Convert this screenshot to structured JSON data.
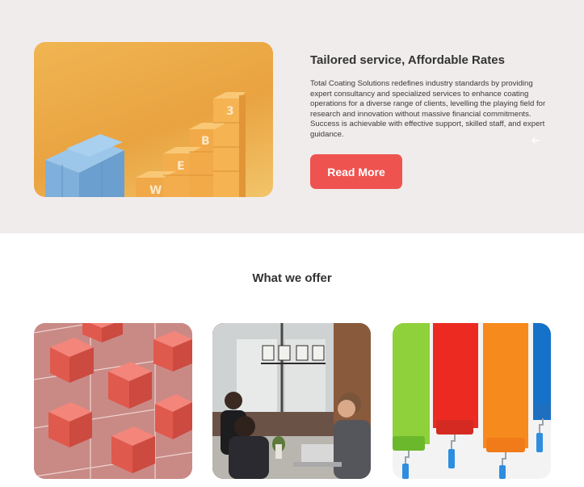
{
  "hero": {
    "title": "Tailored service, Affordable Rates",
    "description": "Total Coating Solutions redefines industry standards by providing expert consultancy and specialized services to enhance coating operations for a diverse range of clients, levelling the playing field for research and innovation without massive financial commitments. Success is achievable with effective support, skilled staff, and expert guidance.",
    "button_label": "Read More",
    "image_letters": [
      "W",
      "E",
      "B",
      "3"
    ],
    "arrow_icon": "arrow-left-icon"
  },
  "offer": {
    "title": "What we offer",
    "cards": [
      {
        "image": "red-cubes-image"
      },
      {
        "image": "meeting-people-image"
      },
      {
        "image": "paint-rollers-image"
      }
    ]
  },
  "colors": {
    "hero_background": "#f1ecec",
    "accent": "#ef5350",
    "text": "#333333"
  }
}
